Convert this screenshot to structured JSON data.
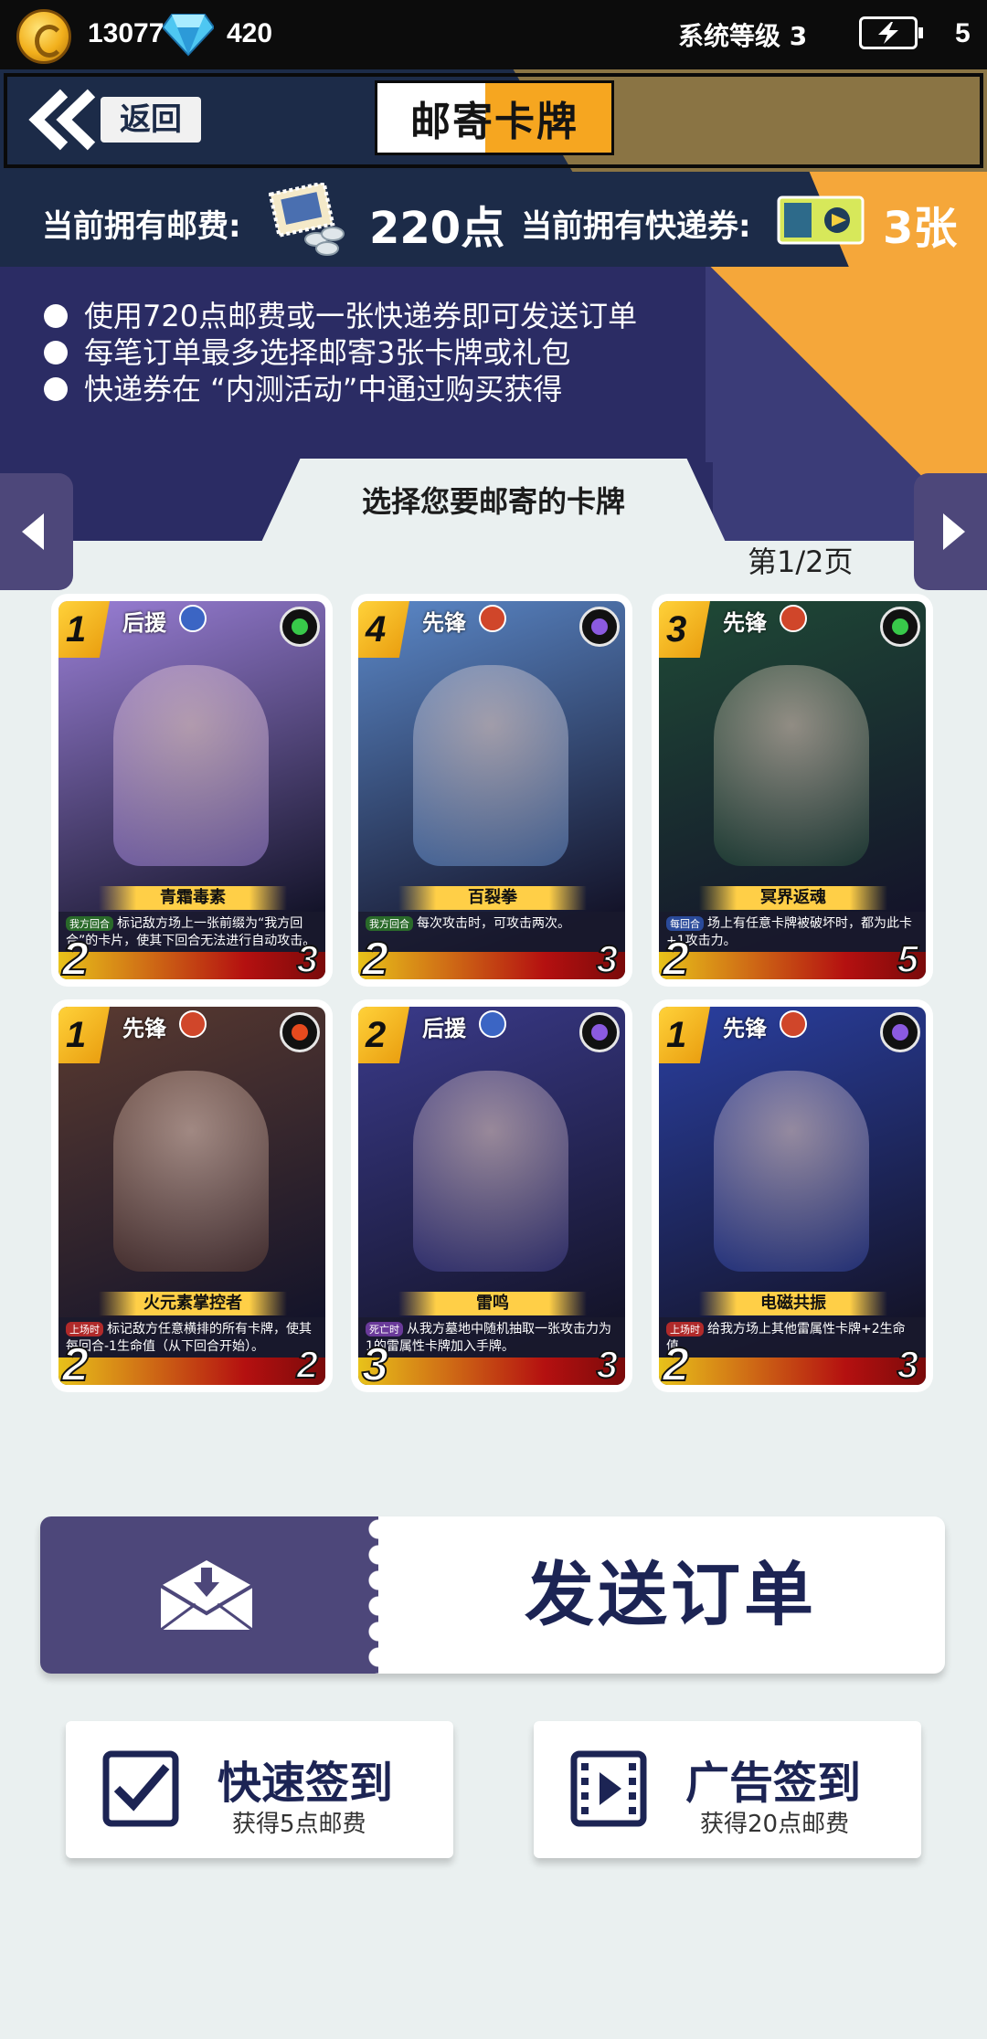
{
  "status": {
    "gold": "13077",
    "gems": "420",
    "system_level": "系统等级 3",
    "energy": "5"
  },
  "header": {
    "back_label": "返回",
    "title": "邮寄卡牌"
  },
  "currencies": {
    "postage_label": "当前拥有邮费:",
    "postage_value": "220点",
    "ticket_label": "当前拥有快递券:",
    "ticket_value": "3张"
  },
  "info": [
    "使用720点邮费或一张快递券即可发送订单",
    "每笔订单最多选择邮寄3张卡牌或礼包",
    "快递券在 “内测活动”中通过购买获得"
  ],
  "selector": {
    "title": "选择您要邮寄的卡牌",
    "page_indicator": "第1/2页"
  },
  "cards": [
    {
      "cost": "1",
      "role": "后援",
      "role_type": "support",
      "element": "toxic",
      "name": "青霜毒素",
      "tag": "我方回合",
      "tag_color": "green",
      "desc": "标记敌方场上一张前缀为“我方回合”的卡片，使其下回合无法进行自动攻击。",
      "atk": "2",
      "hp": "3",
      "palette": "#9a7fd6"
    },
    {
      "cost": "4",
      "role": "先锋",
      "role_type": "vanguard",
      "element": "thunder",
      "name": "百裂拳",
      "tag": "我方回合",
      "tag_color": "green",
      "desc": "每次攻击时，可攻击两次。",
      "atk": "2",
      "hp": "3",
      "palette": "#5b88c8"
    },
    {
      "cost": "3",
      "role": "先锋",
      "role_type": "vanguard",
      "element": "toxic",
      "name": "冥界返魂",
      "tag": "每回合",
      "tag_color": "blue",
      "desc": "场上有任意卡牌被破坏时，都为此卡+1攻击力。",
      "atk": "2",
      "hp": "5",
      "palette": "#1f4a36"
    },
    {
      "cost": "1",
      "role": "先锋",
      "role_type": "vanguard",
      "element": "fire",
      "name": "火元素掌控者",
      "tag": "上场时",
      "tag_color": "red",
      "desc": "标记敌方任意横排的所有卡牌，使其每回合-1生命值（从下回合开始）。",
      "atk": "2",
      "hp": "2",
      "palette": "#5a3a30"
    },
    {
      "cost": "2",
      "role": "后援",
      "role_type": "support",
      "element": "thunder",
      "name": "雷鸣",
      "tag": "死亡时",
      "tag_color": "purple",
      "desc": "从我方墓地中随机抽取一张攻击力为1的雷属性卡牌加入手牌。",
      "atk": "3",
      "hp": "3",
      "palette": "#3a3a8a"
    },
    {
      "cost": "1",
      "role": "先锋",
      "role_type": "vanguard",
      "element": "thunder",
      "name": "电磁共振",
      "tag": "上场时",
      "tag_color": "red",
      "desc": "给我方场上其他雷属性卡牌+2生命值。",
      "atk": "2",
      "hp": "3",
      "palette": "#2a3fa0"
    }
  ],
  "send": {
    "label": "发送订单"
  },
  "checkins": [
    {
      "title": "快速签到",
      "subtitle": "获得5点邮费",
      "icon": "checkbox-icon"
    },
    {
      "title": "广告签到",
      "subtitle": "获得20点邮费",
      "icon": "video-icon"
    }
  ],
  "colors": {
    "navy": "#1c2b48",
    "purple_panel": "#2b2c64",
    "orange": "#f5a73a",
    "button_purple": "#4d477a",
    "text_navy": "#1c2454"
  }
}
